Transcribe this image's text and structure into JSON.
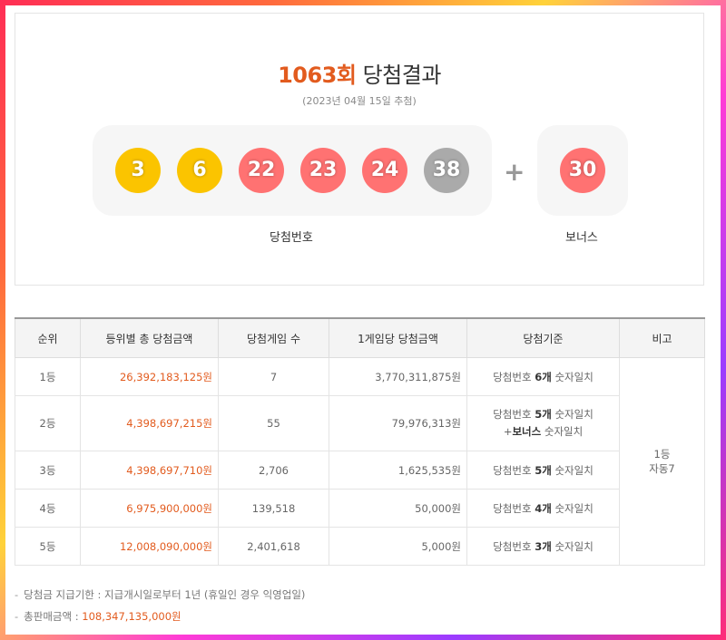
{
  "result": {
    "round_label": "1063회",
    "title_suffix": " 당첨결과",
    "date": "(2023년 04월 15일 추첨)",
    "numbers": [
      3,
      6,
      22,
      23,
      24,
      38
    ],
    "bonus": 30,
    "numbers_label": "당첨번호",
    "bonus_label": "보너스",
    "plus": "+",
    "colors": {
      "yellow": "#fbc400",
      "red": "#ff7272",
      "gray": "#aaaaaa",
      "accent": "#e25b1e"
    }
  },
  "table": {
    "headers": [
      "순위",
      "등위별 총 당첨금액",
      "당첨게임 수",
      "1게임당 당첨금액",
      "당첨기준",
      "비고"
    ],
    "rows": [
      {
        "rank": "1등",
        "total": "26,392,183,125원",
        "games": "7",
        "per_game": "3,770,311,875원",
        "crit_pre": "당첨번호 ",
        "crit_bold": "6개",
        "crit_post": " 숫자일치"
      },
      {
        "rank": "2등",
        "total": "4,398,697,215원",
        "games": "55",
        "per_game": "79,976,313원",
        "crit_pre": "당첨번호 ",
        "crit_bold": "5개",
        "crit_post": " 숫자일치",
        "crit2_pre": "+",
        "crit2_bold": "보너스",
        "crit2_post": " 숫자일치"
      },
      {
        "rank": "3등",
        "total": "4,398,697,710원",
        "games": "2,706",
        "per_game": "1,625,535원",
        "crit_pre": "당첨번호 ",
        "crit_bold": "5개",
        "crit_post": " 숫자일치"
      },
      {
        "rank": "4등",
        "total": "6,975,900,000원",
        "games": "139,518",
        "per_game": "50,000원",
        "crit_pre": "당첨번호 ",
        "crit_bold": "4개",
        "crit_post": " 숫자일치"
      },
      {
        "rank": "5등",
        "total": "12,008,090,000원",
        "games": "2,401,618",
        "per_game": "5,000원",
        "crit_pre": "당첨번호 ",
        "crit_bold": "3개",
        "crit_post": " 숫자일치"
      }
    ],
    "note_line1": "1등",
    "note_line2": "자동7"
  },
  "notes": {
    "dash": "-",
    "deadline": "당첨금 지급기한 : 지급개시일로부터 1년 (휴일인 경우 익영업일)",
    "sales_label": "총판매금액 : ",
    "sales_value": "108,347,135,000원"
  }
}
